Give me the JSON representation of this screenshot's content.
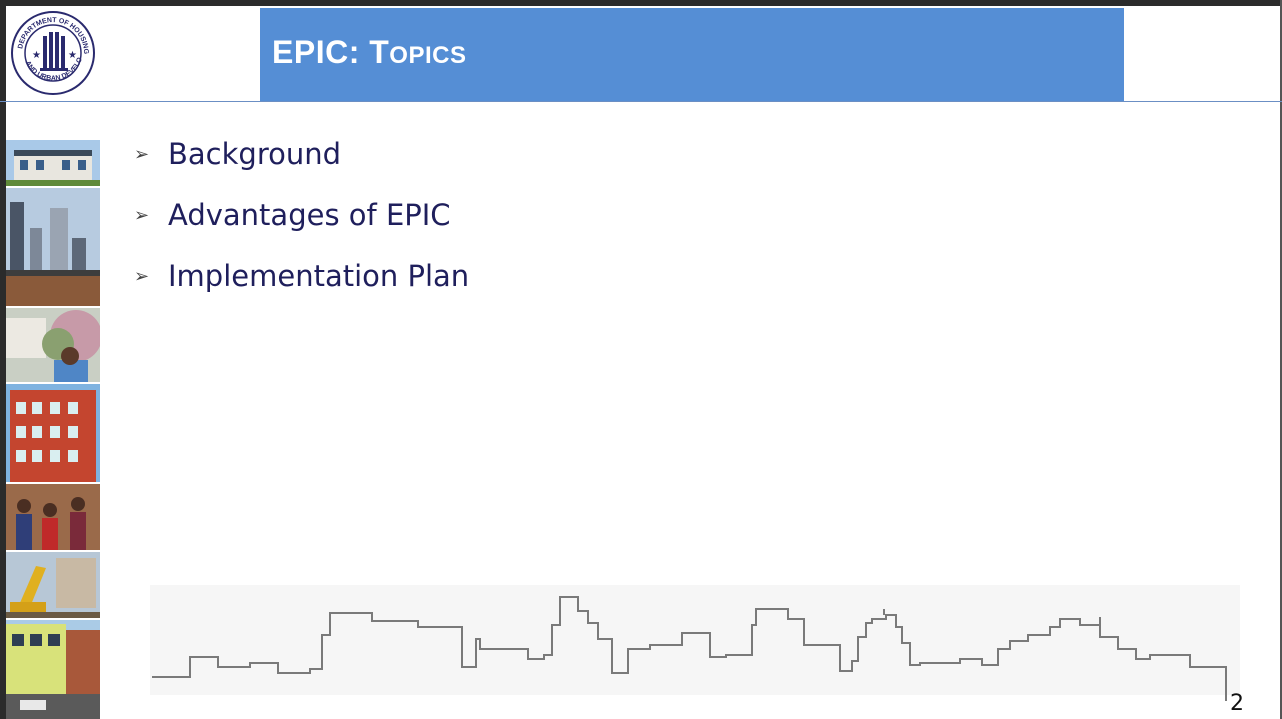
{
  "header": {
    "title_main": "EPIC:  T",
    "title_rest": "OPICS"
  },
  "bullets": [
    {
      "label": "Background"
    },
    {
      "label": "Advantages of EPIC"
    },
    {
      "label": "Implementation Plan"
    }
  ],
  "footer": {
    "page_number": "2"
  },
  "colors": {
    "title_bar": "#558ed5",
    "bullet_text": "#1f1f5c"
  },
  "icons": {
    "logo": "hud-seal-logo",
    "bullet": "arrowhead-bullet-icon"
  }
}
